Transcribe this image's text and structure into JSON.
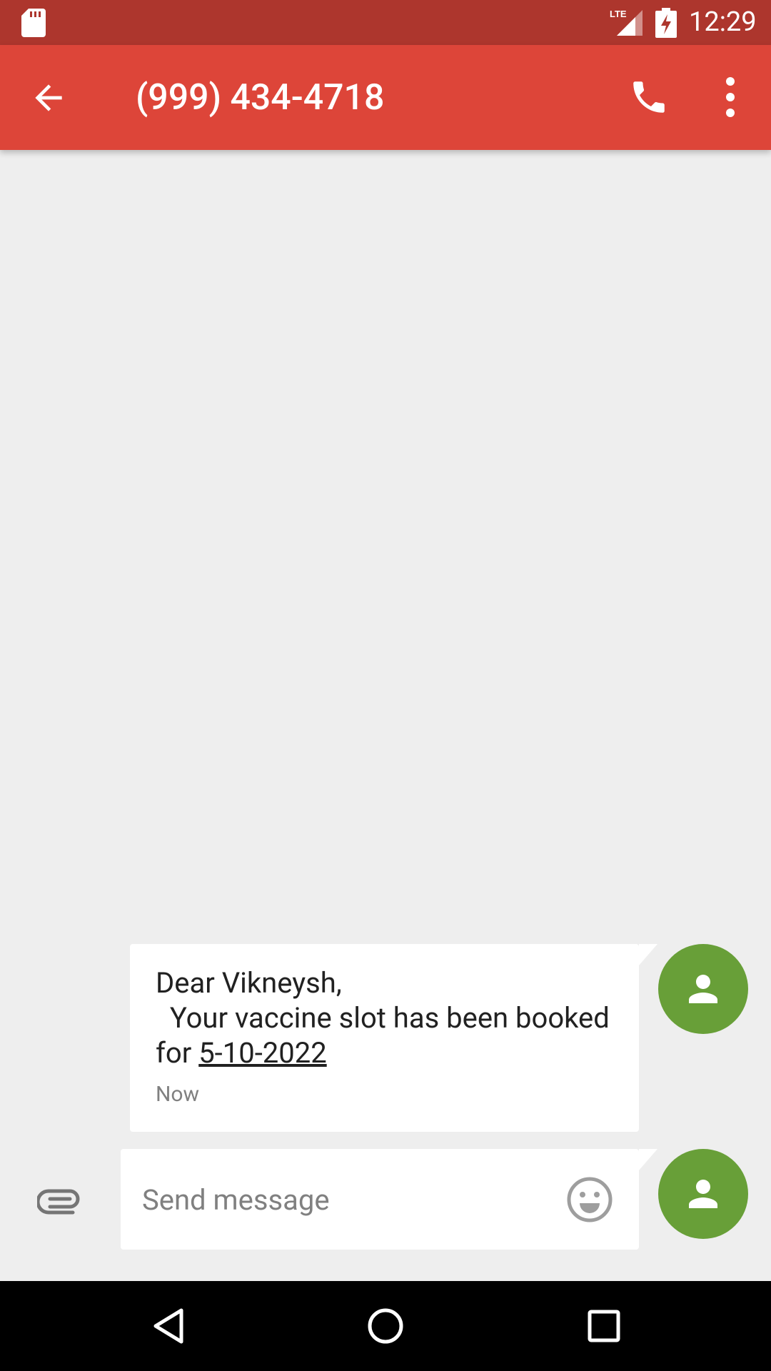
{
  "status_bar": {
    "time": "12:29",
    "network_label": "LTE",
    "icons": [
      "sd-card-icon",
      "signal-icon",
      "battery-charging-icon"
    ]
  },
  "toolbar": {
    "title": "(999) 434-4718",
    "icons": [
      "back-arrow-icon",
      "phone-icon",
      "more-vert-icon"
    ]
  },
  "conversation": {
    "messages": [
      {
        "text_before_link": "Dear Vikneysh,\n  Your vaccine slot has been booked for ",
        "link_text": "5-10-2022",
        "timestamp": "Now"
      }
    ]
  },
  "compose": {
    "placeholder": "Send message",
    "value": ""
  },
  "colors": {
    "status_bar": "#ad362d",
    "toolbar": "#dd4539",
    "avatar": "#689f38",
    "background": "#eeeeee"
  }
}
